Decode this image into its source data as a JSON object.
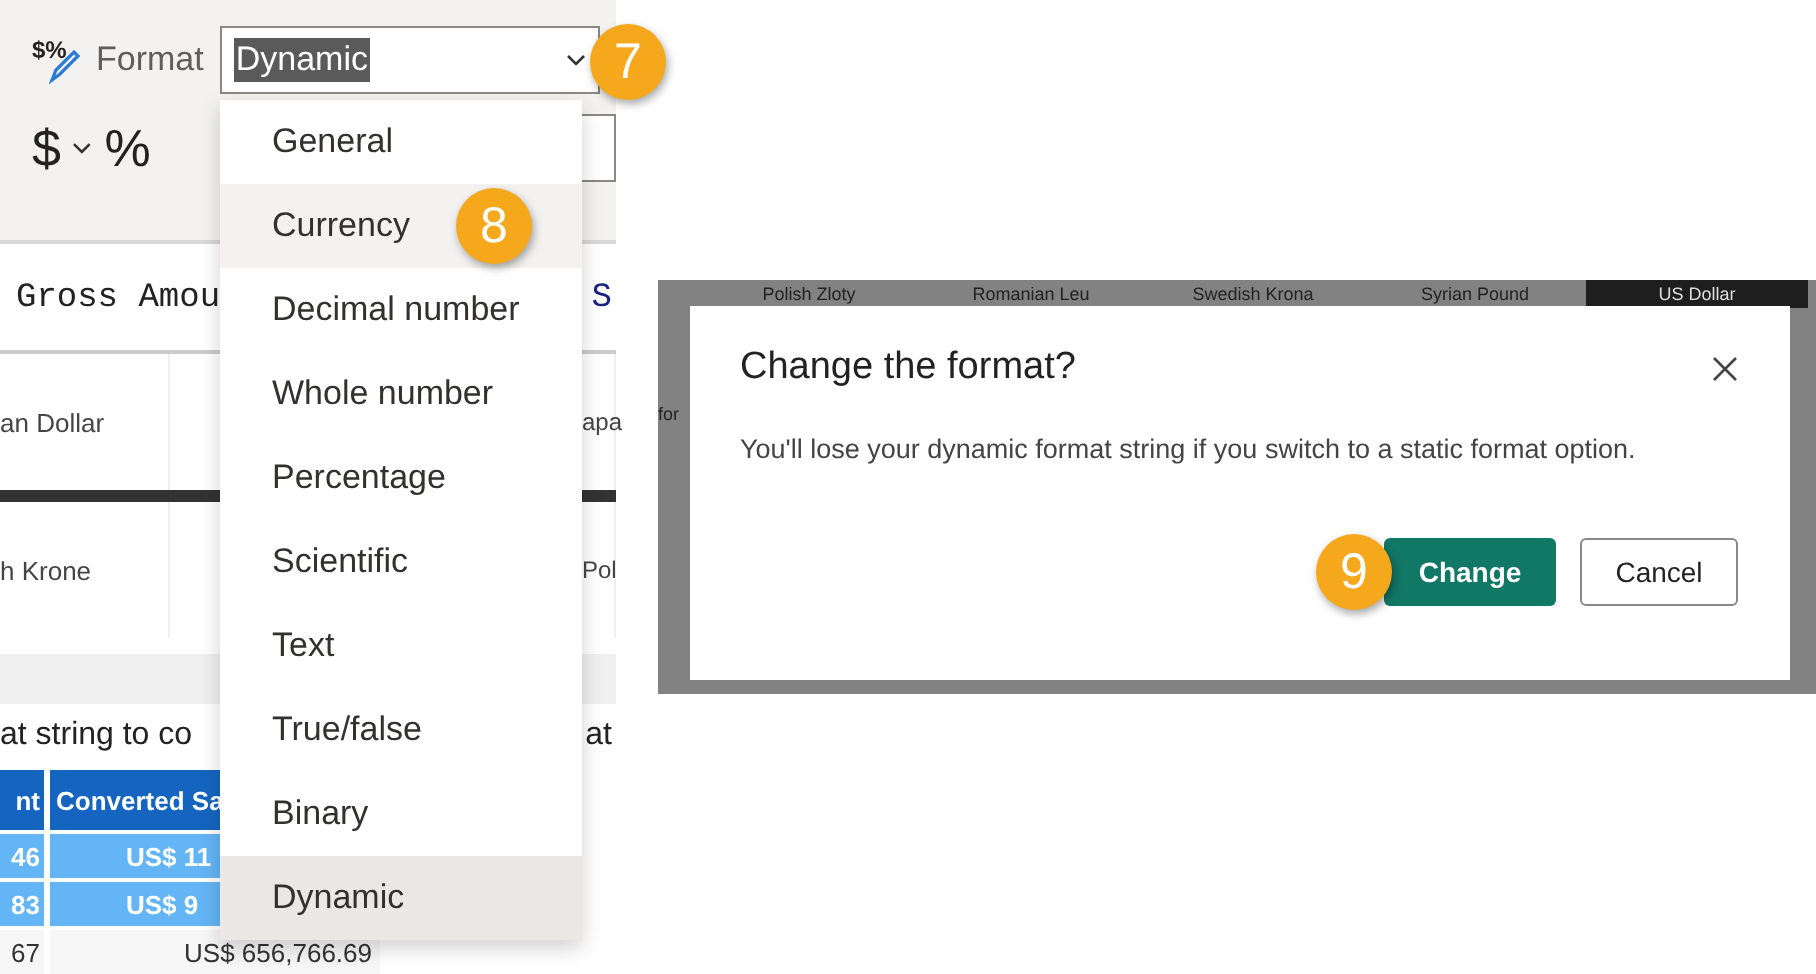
{
  "ribbon": {
    "format_icon_text": "$%",
    "format_label": "Format",
    "format_combo": {
      "value": "Dynamic",
      "text_selected": true,
      "callout": "7"
    },
    "currency_symbol": "$",
    "percent_symbol": "%"
  },
  "format_dropdown": {
    "items": [
      {
        "label": "General",
        "selected": false,
        "hovered": false
      },
      {
        "label": "Currency",
        "selected": false,
        "hovered": true,
        "callout": "8"
      },
      {
        "label": "Decimal number",
        "selected": false,
        "hovered": false
      },
      {
        "label": "Whole number",
        "selected": false,
        "hovered": false
      },
      {
        "label": "Percentage",
        "selected": false,
        "hovered": false
      },
      {
        "label": "Scientific",
        "selected": false,
        "hovered": false
      },
      {
        "label": "Text",
        "selected": false,
        "hovered": false
      },
      {
        "label": "True/false",
        "selected": false,
        "hovered": false
      },
      {
        "label": "Binary",
        "selected": false,
        "hovered": false
      },
      {
        "label": "Dynamic",
        "selected": true,
        "hovered": false
      }
    ]
  },
  "report": {
    "heading_left": "Gross Amou",
    "heading_right": "S",
    "slicer_rows": [
      {
        "left": "an Dollar",
        "right": "apa"
      },
      {
        "left": "h Krone",
        "right": "Pol"
      }
    ],
    "subtitle_left": "at string to co",
    "subtitle_right": "at",
    "table": {
      "columns": [
        "nt",
        "Converted Sa"
      ],
      "rows": [
        {
          "cells": [
            "46",
            "US$ 11"
          ],
          "highlighted": true
        },
        {
          "cells": [
            "83",
            "US$ 9"
          ],
          "highlighted": true
        },
        {
          "cells": [
            "67",
            "US$ 656,766.69"
          ],
          "highlighted": false
        }
      ]
    }
  },
  "dialog_backdrop": {
    "slicer_tabs": [
      {
        "label": "Polish Zloty",
        "selected": false
      },
      {
        "label": "Romanian Leu",
        "selected": false
      },
      {
        "label": "Swedish Krona",
        "selected": false
      },
      {
        "label": "Syrian Pound",
        "selected": false
      },
      {
        "label": "US Dollar",
        "selected": true
      }
    ],
    "side_text": "for"
  },
  "dialog": {
    "title": "Change the format?",
    "message": "You'll lose your dynamic format string if you switch to a static format option.",
    "buttons": [
      {
        "label": "Change",
        "kind": "primary",
        "callout": "9"
      },
      {
        "label": "Cancel",
        "kind": "secondary"
      }
    ]
  }
}
